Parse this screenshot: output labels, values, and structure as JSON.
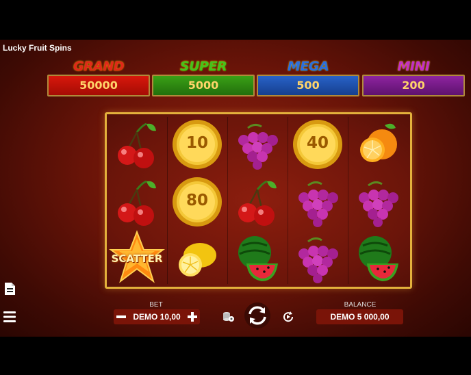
{
  "app": {
    "title": "Lucky Fruit Spins"
  },
  "jackpots": [
    {
      "label": "GRAND",
      "value": "50000",
      "label_color": "#e0281a",
      "box_color": "#c4150c"
    },
    {
      "label": "SUPER",
      "value": "5000",
      "label_color": "#46c21c",
      "box_color": "#2f8a14"
    },
    {
      "label": "MEGA",
      "value": "500",
      "label_color": "#2a6ee0",
      "box_color": "#1d4fa8"
    },
    {
      "label": "MINI",
      "value": "200",
      "label_color": "#c22ec8",
      "box_color": "#7a1a8a"
    }
  ],
  "reels": {
    "symbols": [
      [
        "cherry-icon",
        "coin-icon",
        "grapes-icon",
        "coin-icon",
        "orange-icon"
      ],
      [
        "cherry-icon",
        "coin-icon",
        "cherry-icon",
        "grapes-icon",
        "grapes-icon"
      ],
      [
        "scatter-icon",
        "lemon-icon",
        "watermelon-icon",
        "grapes-icon",
        "watermelon-icon"
      ]
    ],
    "coin_values": {
      "r0c1": "10",
      "r0c3": "40",
      "r1c1": "80"
    },
    "scatter_label": "SCATTER"
  },
  "controls": {
    "bet_label": "BET",
    "bet_value": "DEMO 10,00",
    "balance_label": "BALANCE",
    "balance_value": "DEMO 5 000,00"
  },
  "colors": {
    "frame": "#e3b13c",
    "accent": "#ffd46a"
  }
}
